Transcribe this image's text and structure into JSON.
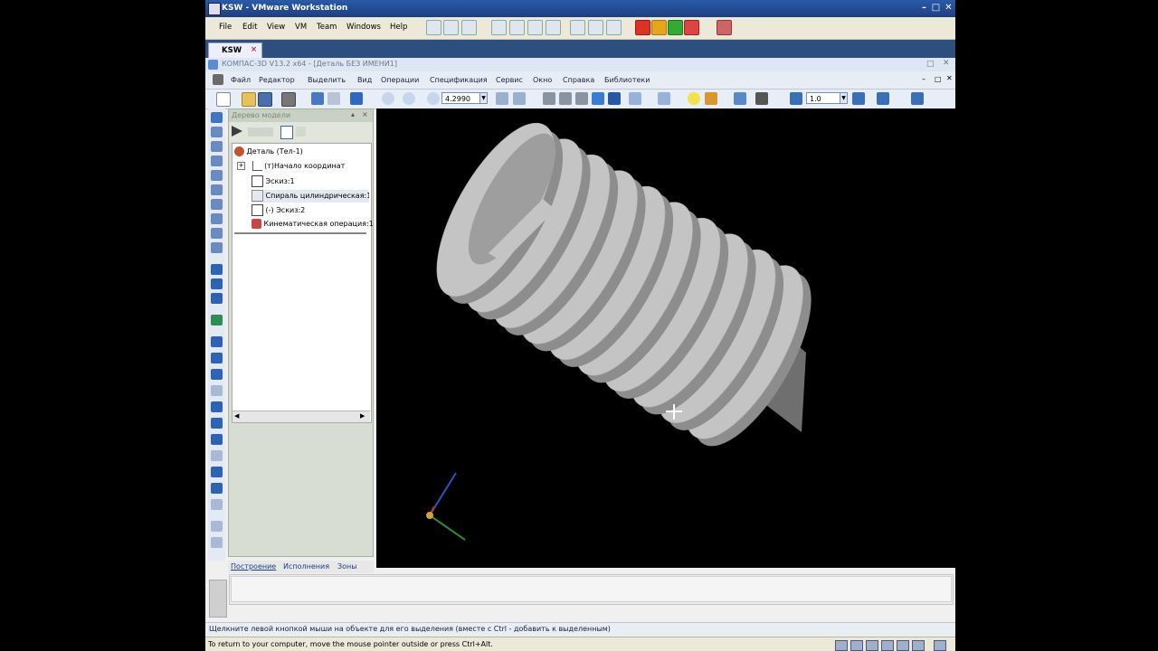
{
  "vmware": {
    "window_title": "KSW - VMware Workstation",
    "menu": [
      "File",
      "Edit",
      "View",
      "VM",
      "Team",
      "Windows",
      "Help"
    ],
    "tab": "KSW",
    "status": "To return to your computer, move the mouse pointer outside or press Ctrl+Alt."
  },
  "kompas": {
    "title": "КОМПАС-3D V13.2 x64 - [Деталь БЕЗ ИМЕНИ1]",
    "menu": [
      "Файл",
      "Редактор",
      "Выделить",
      "Вид",
      "Операции",
      "Спецификация",
      "Сервис",
      "Окно",
      "Справка",
      "Библиотеки"
    ],
    "zoom": "4.2990",
    "scale": "1.0",
    "tree": {
      "title": "Дерево модели",
      "items": [
        "Деталь (Тел-1)",
        "(т)Начало координат",
        "Эскиз:1",
        "Спираль цилиндрическая:1",
        "(-) Эскиз:2",
        "Кинематическая операция:1"
      ],
      "tabs": [
        "Построение",
        "Исполнения",
        "Зоны"
      ]
    },
    "status": "Щелкните левой кнопкой мыши на объекте для его выделения (вместе с Ctrl - добавить к выделенным)"
  },
  "colors": {
    "vm_title": "#1d3f82",
    "viewport_bg": "#000000",
    "model_face": "#c4c4c4",
    "model_side": "#8d8d8d"
  }
}
